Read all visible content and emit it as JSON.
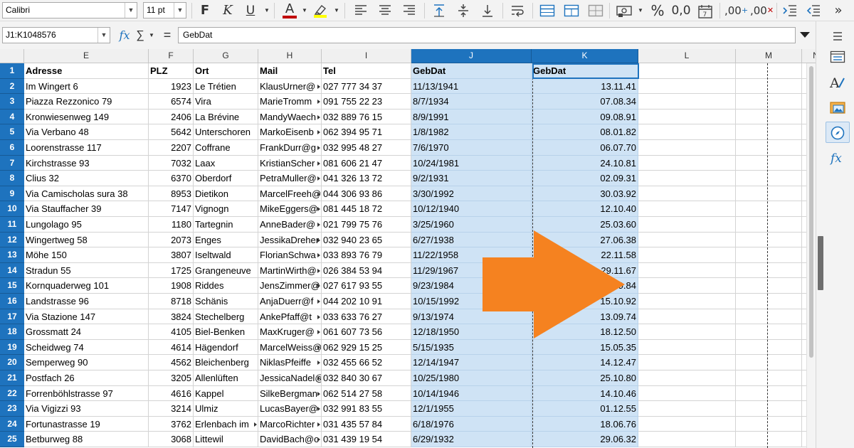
{
  "toolbar": {
    "font_name": "Calibri",
    "font_size": "11 pt",
    "bold": "F",
    "italic": "K",
    "underline": "U",
    "font_color": "A",
    "percent": "%",
    "decimal_zero": "0,0",
    "add_decimal": ",00",
    "del_decimal": ",00",
    "more": "»",
    "accent_font_color": "#c00000",
    "accent_highlight": "#ffff00"
  },
  "formula_bar": {
    "name_box": "J1:K1048576",
    "fx": "fx",
    "sum": "∑",
    "equals": "=",
    "content": "GebDat"
  },
  "sheet": {
    "columns": [
      {
        "label": "E",
        "selected": false
      },
      {
        "label": "F",
        "selected": false
      },
      {
        "label": "G",
        "selected": false
      },
      {
        "label": "H",
        "selected": false
      },
      {
        "label": "I",
        "selected": false
      },
      {
        "label": "J",
        "selected": true
      },
      {
        "label": "K",
        "selected": true
      },
      {
        "label": "L",
        "selected": false
      },
      {
        "label": "M",
        "selected": false
      },
      {
        "label": "N",
        "selected": false
      }
    ],
    "rows": [
      {
        "num": "1",
        "cells": [
          "Adresse",
          "PLZ",
          "Ort",
          "Mail",
          "Tel",
          "GebDat",
          "GebDat",
          "",
          "",
          ""
        ]
      },
      {
        "num": "2",
        "cells": [
          "Im Wingert 6",
          "1923",
          "Le Trétien",
          "KlausUrner@",
          "027 777 34 37",
          "11/13/1941",
          "13.11.41",
          "",
          "",
          ""
        ]
      },
      {
        "num": "3",
        "cells": [
          "Piazza Rezzonico 79",
          "6574",
          "Vira",
          "MarieTromm",
          "091 755 22 23",
          "8/7/1934",
          "07.08.34",
          "",
          "",
          ""
        ]
      },
      {
        "num": "4",
        "cells": [
          "Kronwiesenweg 149",
          "2406",
          "La Brévine",
          "MandyWaech",
          "032 889 76 15",
          "8/9/1991",
          "09.08.91",
          "",
          "",
          ""
        ]
      },
      {
        "num": "5",
        "cells": [
          "Via Verbano 48",
          "5642",
          "Unterschoren",
          "MarkoEisenb",
          "062 394 95 71",
          "1/8/1982",
          "08.01.82",
          "",
          "",
          ""
        ]
      },
      {
        "num": "6",
        "cells": [
          "Loorenstrasse 117",
          "2207",
          "Coffrane",
          "FrankDurr@g",
          "032 995 48 27",
          "7/6/1970",
          "06.07.70",
          "",
          "",
          ""
        ]
      },
      {
        "num": "7",
        "cells": [
          "Kirchstrasse 93",
          "7032",
          "Laax",
          "KristianScher",
          "081 606 21 47",
          "10/24/1981",
          "24.10.81",
          "",
          "",
          ""
        ]
      },
      {
        "num": "8",
        "cells": [
          "Clius 32",
          "6370",
          "Oberdorf",
          "PetraMuller@",
          "041 326 13 72",
          "9/2/1931",
          "02.09.31",
          "",
          "",
          ""
        ]
      },
      {
        "num": "9",
        "cells": [
          "Via Camischolas sura 38",
          "8953",
          "Dietikon",
          "MarcelFreeh@",
          "044 306 93 86",
          "3/30/1992",
          "30.03.92",
          "",
          "",
          ""
        ]
      },
      {
        "num": "10",
        "cells": [
          "Via Stauffacher 39",
          "7147",
          "Vignogn",
          "MikeEggers@",
          "081 445 18 72",
          "10/12/1940",
          "12.10.40",
          "",
          "",
          ""
        ]
      },
      {
        "num": "11",
        "cells": [
          "Lungolago 95",
          "1180",
          "Tartegnin",
          "AnneBader@",
          "021 799 75 76",
          "3/25/1960",
          "25.03.60",
          "",
          "",
          ""
        ]
      },
      {
        "num": "12",
        "cells": [
          "Wingertweg 58",
          "2073",
          "Enges",
          "JessikaDreher",
          "032 940 23 65",
          "6/27/1938",
          "27.06.38",
          "",
          "",
          ""
        ]
      },
      {
        "num": "13",
        "cells": [
          "Möhe 150",
          "3807",
          "Iseltwald",
          "FlorianSchwa",
          "033 893 76 79",
          "11/22/1958",
          "22.11.58",
          "",
          "",
          ""
        ]
      },
      {
        "num": "14",
        "cells": [
          "Stradun 55",
          "1725",
          "Grangeneuve",
          "MartinWirth@",
          "026 384 53 94",
          "11/29/1967",
          "29.11.67",
          "",
          "",
          ""
        ]
      },
      {
        "num": "15",
        "cells": [
          "Kornquaderweg 101",
          "1908",
          "Riddes",
          "JensZimmer@",
          "027 617 93 55",
          "9/23/1984",
          "23.09.84",
          "",
          "",
          ""
        ]
      },
      {
        "num": "16",
        "cells": [
          "Landstrasse 96",
          "8718",
          "Schänis",
          "AnjaDuerr@f",
          "044 202 10 91",
          "10/15/1992",
          "15.10.92",
          "",
          "",
          ""
        ]
      },
      {
        "num": "17",
        "cells": [
          "Via Stazione 147",
          "3824",
          "Stechelberg",
          "AnkePfaff@t",
          "033 633 76 27",
          "9/13/1974",
          "13.09.74",
          "",
          "",
          ""
        ]
      },
      {
        "num": "18",
        "cells": [
          "Grossmatt 24",
          "4105",
          "Biel-Benken",
          "MaxKruger@",
          "061 607 73 56",
          "12/18/1950",
          "18.12.50",
          "",
          "",
          ""
        ]
      },
      {
        "num": "19",
        "cells": [
          "Scheidweg 74",
          "4614",
          "Hägendorf",
          "MarcelWeiss@",
          "062 929 15 25",
          "5/15/1935",
          "15.05.35",
          "",
          "",
          ""
        ]
      },
      {
        "num": "20",
        "cells": [
          "Semperweg 90",
          "4562",
          "Bleichenberg",
          "NiklasPfeiffe",
          "032 455 66 52",
          "12/14/1947",
          "14.12.47",
          "",
          "",
          ""
        ]
      },
      {
        "num": "21",
        "cells": [
          "Postfach 26",
          "3205",
          "Allenlüften",
          "JessicaNadel@",
          "032 840 30 67",
          "10/25/1980",
          "25.10.80",
          "",
          "",
          ""
        ]
      },
      {
        "num": "22",
        "cells": [
          "Forrenböhlstrasse 97",
          "4616",
          "Kappel",
          "SilkeBergman",
          "062 514 27 58",
          "10/14/1946",
          "14.10.46",
          "",
          "",
          ""
        ]
      },
      {
        "num": "23",
        "cells": [
          "Via Vigizzi 93",
          "3214",
          "Ulmiz",
          "LucasBayer@",
          "032 991 83 55",
          "12/1/1955",
          "01.12.55",
          "",
          "",
          ""
        ]
      },
      {
        "num": "24",
        "cells": [
          "Fortunastrasse 19",
          "3762",
          "Erlenbach im",
          "MarcoRichter",
          "031 435 57 84",
          "6/18/1976",
          "18.06.76",
          "",
          "",
          ""
        ]
      },
      {
        "num": "25",
        "cells": [
          "Betburweg 88",
          "3068",
          "Littewil",
          "DavidBach@o",
          "031 439 19 54",
          "6/29/1932",
          "29.06.32",
          "",
          "",
          ""
        ]
      }
    ],
    "selection_color": "#cfe3f5",
    "header_selected_color": "#1e73be",
    "annotation_arrow_color": "#f58220",
    "annotation_arrow_icon": "arrow-right-icon"
  },
  "sidebar": {
    "icons": [
      "hamburger-menu-icon",
      "properties-icon",
      "styles-icon",
      "gallery-icon",
      "navigator-icon",
      "functions-icon"
    ]
  }
}
